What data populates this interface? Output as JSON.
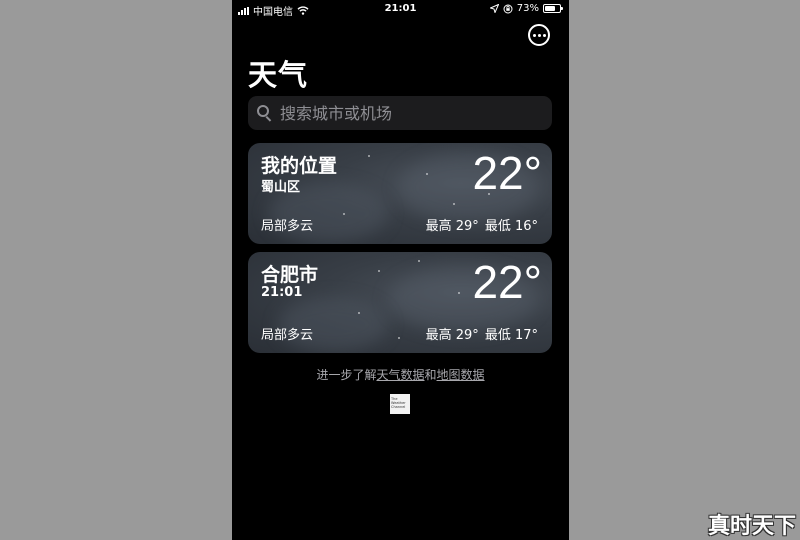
{
  "status_bar": {
    "carrier": "中国电信",
    "time": "21:01",
    "battery_percent": "73%",
    "battery_level": 0.73
  },
  "title": "天气",
  "search": {
    "placeholder": "搜索城市或机场"
  },
  "cities": [
    {
      "name": "我的位置",
      "subtitle": "蜀山区",
      "temperature": "22°",
      "condition": "局部多云",
      "high": "最高 29°",
      "low": "最低 16°"
    },
    {
      "name": "合肥市",
      "subtitle": "21:01",
      "temperature": "22°",
      "condition": "局部多云",
      "high": "最高 29°",
      "low": "最低 17°"
    }
  ],
  "footer": {
    "prefix": "进一步了解",
    "link_weather": "天气数据",
    "connector": "和",
    "link_map": "地图数据"
  },
  "provider_logo": {
    "line1": "The",
    "line2": "Weather",
    "line3": "Channel"
  },
  "watermark": "真时天下",
  "icons": {
    "signal": "signal-icon",
    "wifi": "wifi-icon",
    "location": "location-arrow-icon",
    "lock": "orientation-lock-icon",
    "battery": "battery-icon",
    "more": "ellipsis-circle-icon",
    "search": "search-icon"
  }
}
